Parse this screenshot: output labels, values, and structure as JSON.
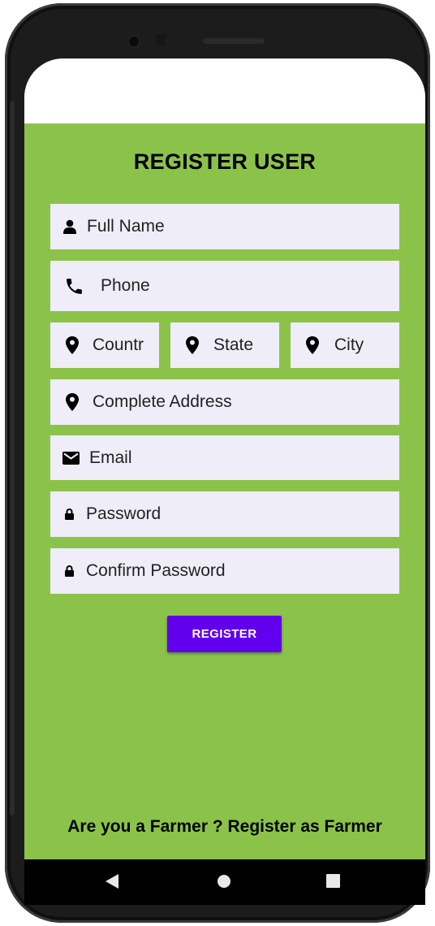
{
  "screen": {
    "title": "REGISTER USER",
    "background_color": "#8bc34a",
    "field_background": "#efedf8"
  },
  "form": {
    "full_name": {
      "placeholder": "Full Name",
      "icon": "person-icon"
    },
    "phone": {
      "placeholder": "Phone",
      "icon": "phone-icon"
    },
    "country": {
      "placeholder": "Countr",
      "icon": "location-pin-icon"
    },
    "state": {
      "placeholder": "State",
      "icon": "location-pin-icon"
    },
    "city": {
      "placeholder": "City",
      "icon": "location-pin-icon"
    },
    "address": {
      "placeholder": "Complete Address",
      "icon": "location-pin-icon"
    },
    "email": {
      "placeholder": "Email",
      "icon": "mail-icon"
    },
    "password": {
      "placeholder": "Password",
      "icon": "lock-icon"
    },
    "confirm_password": {
      "placeholder": "Confirm Password",
      "icon": "lock-icon"
    }
  },
  "register_button": {
    "label": "REGISTER",
    "color": "#6200ee"
  },
  "footer": {
    "farmer_link": "Are you a Farmer ? Register as Farmer"
  },
  "navigation": {
    "back": "back-icon",
    "home": "home-icon",
    "recents": "recents-icon"
  }
}
